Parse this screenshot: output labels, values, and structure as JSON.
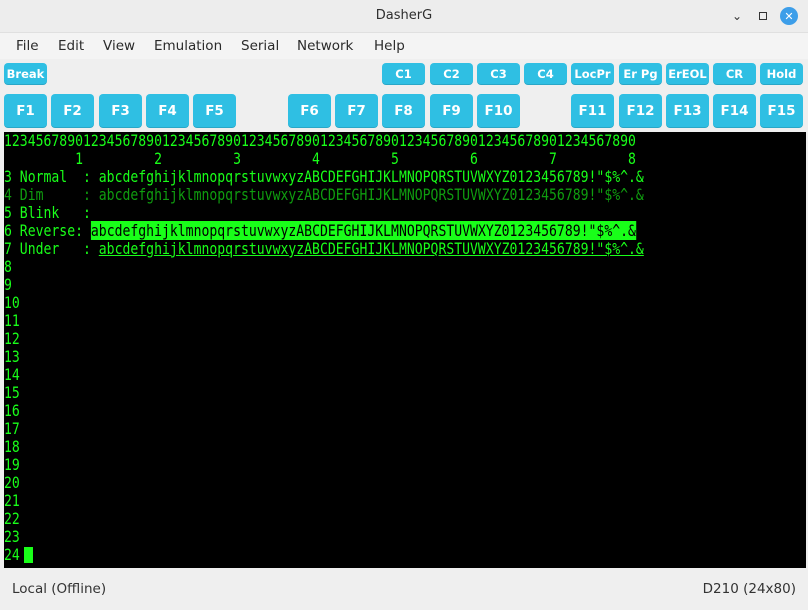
{
  "window": {
    "title": "DasherG"
  },
  "menu": [
    "File",
    "Edit",
    "View",
    "Emulation",
    "Serial",
    "Network",
    "Help"
  ],
  "top_buttons": [
    "Break",
    "C1",
    "C2",
    "C3",
    "C4",
    "LocPr",
    "Er Pg",
    "ErEOL",
    "CR",
    "Hold"
  ],
  "fkeys": [
    "F1",
    "F2",
    "F3",
    "F4",
    "F5",
    "F6",
    "F7",
    "F8",
    "F9",
    "F10",
    "F11",
    "F12",
    "F13",
    "F14",
    "F15"
  ],
  "terminal": {
    "lines": [
      [
        {
          "t": "12345678901234567890123456789012345678901234567890123456789012345678901234567890",
          "s": ""
        }
      ],
      [
        {
          "t": "         1         2         3         4         5         6         7         8",
          "s": ""
        }
      ],
      [
        {
          "t": "3 Normal  : ",
          "s": ""
        },
        {
          "t": "abcdefghijklmnopqrstuvwxyzABCDEFGHIJKLMNOPQRSTUVWXYZ0123456789!\"$%^.&",
          "s": ""
        }
      ],
      [
        {
          "t": "4 Dim     : ",
          "s": "dim"
        },
        {
          "t": "abcdefghijklmnopqrstuvwxyzABCDEFGHIJKLMNOPQRSTUVWXYZ0123456789!\"$%^.&",
          "s": "dim"
        }
      ],
      [
        {
          "t": "5 Blink   :",
          "s": ""
        }
      ],
      [
        {
          "t": "6 Reverse: ",
          "s": ""
        },
        {
          "t": "abcdefghijklmnopqrstuvwxyzABCDEFGHIJKLMNOPQRSTUVWXYZ0123456789!\"$%^.&",
          "s": "rev"
        }
      ],
      [
        {
          "t": "7 Under   : ",
          "s": ""
        },
        {
          "t": "abcdefghijklmnopqrstuvwxyzABCDEFGHIJKLMNOPQRSTUVWXYZ0123456789!\"$%^.&",
          "s": "und"
        }
      ],
      [
        {
          "t": "8",
          "s": ""
        }
      ],
      [
        {
          "t": "9",
          "s": ""
        }
      ],
      [
        {
          "t": "10",
          "s": ""
        }
      ],
      [
        {
          "t": "11",
          "s": ""
        }
      ],
      [
        {
          "t": "12",
          "s": ""
        }
      ],
      [
        {
          "t": "13",
          "s": ""
        }
      ],
      [
        {
          "t": "14",
          "s": ""
        }
      ],
      [
        {
          "t": "15",
          "s": ""
        }
      ],
      [
        {
          "t": "16",
          "s": ""
        }
      ],
      [
        {
          "t": "17",
          "s": ""
        }
      ],
      [
        {
          "t": "18",
          "s": ""
        }
      ],
      [
        {
          "t": "19",
          "s": ""
        }
      ],
      [
        {
          "t": "20",
          "s": ""
        }
      ],
      [
        {
          "t": "21",
          "s": ""
        }
      ],
      [
        {
          "t": "22",
          "s": ""
        }
      ],
      [
        {
          "t": "23",
          "s": ""
        }
      ],
      [
        {
          "t": "24",
          "s": ""
        }
      ]
    ]
  },
  "status": {
    "left": "Local (Offline)",
    "right": "D210 (24x80)"
  },
  "colors": {
    "button": "#2fbfe3",
    "terminal_fg": "#19ff19",
    "terminal_bg": "#000000",
    "close_button": "#3d9ee9"
  }
}
